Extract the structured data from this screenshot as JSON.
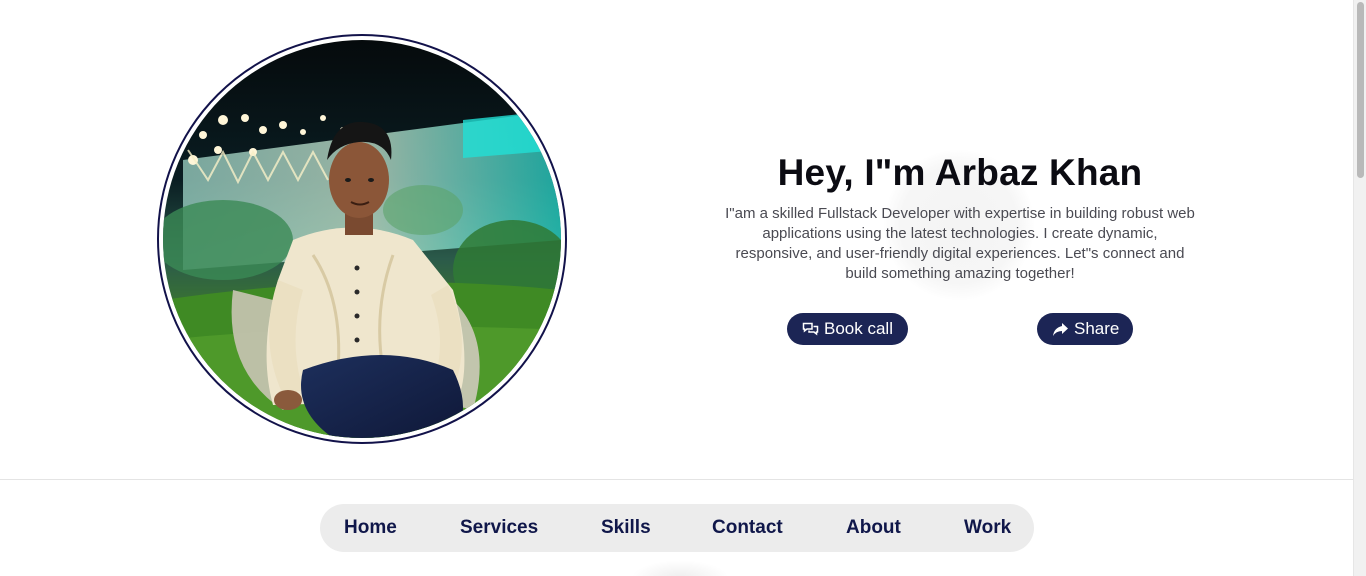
{
  "hero": {
    "title": "Hey, I\"m Arbaz Khan",
    "description": "I\"am a skilled Fullstack Developer with expertise in building robust web applications using the latest technologies. I create dynamic, responsive, and user-friendly digital experiences. Let\"s connect and build something amazing together!",
    "book_call_label": "Book call",
    "book_call_icon": "chat-bubbles-icon",
    "share_label": "Share",
    "share_icon": "share-arrow-icon",
    "avatar_alt": "profile-photo"
  },
  "nav": {
    "items": [
      {
        "label": "Home"
      },
      {
        "label": "Services"
      },
      {
        "label": "Skills"
      },
      {
        "label": "Contact"
      },
      {
        "label": "About"
      },
      {
        "label": "Work"
      }
    ]
  },
  "colors": {
    "accent": "#1c2555",
    "nav_text": "#10174a",
    "nav_bg": "#ececec",
    "ring": "#12124a"
  }
}
